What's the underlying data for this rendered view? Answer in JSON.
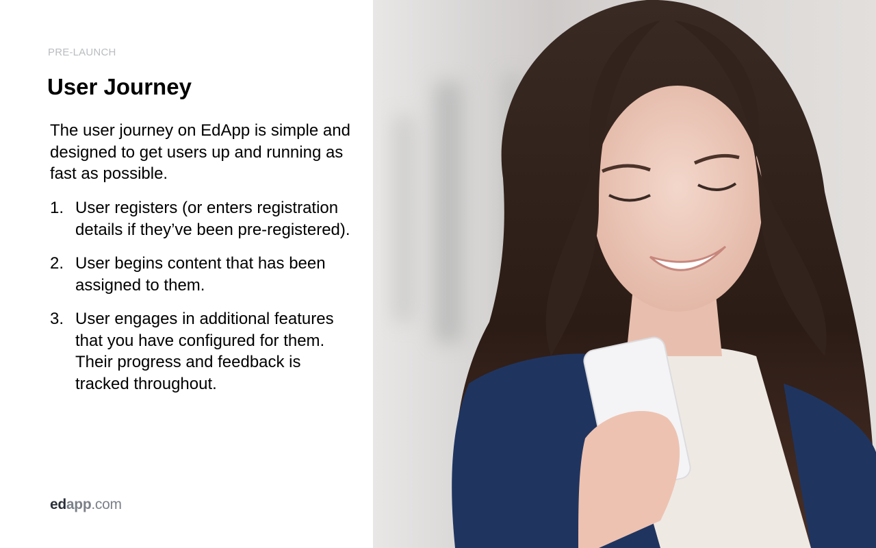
{
  "slide": {
    "eyebrow": "PRE-LAUNCH",
    "title": "User Journey",
    "intro": "The user journey on EdApp is simple and designed to get users up and running as fast as possible.",
    "steps": [
      {
        "number": "1.",
        "text": "User registers (or enters registration details if they’ve been pre-registered)."
      },
      {
        "number": "2.",
        "text": "User begins content that has been assigned to them."
      },
      {
        "number": "3.",
        "text": "User engages in additional features that you have configured for them. Their progress and feedback is tracked throughout."
      }
    ],
    "logo": {
      "part1": "ed",
      "part2": "app",
      "part3": ".com"
    },
    "photo": {
      "description": "Smiling woman with long brown hair looking at a white smartphone"
    }
  }
}
